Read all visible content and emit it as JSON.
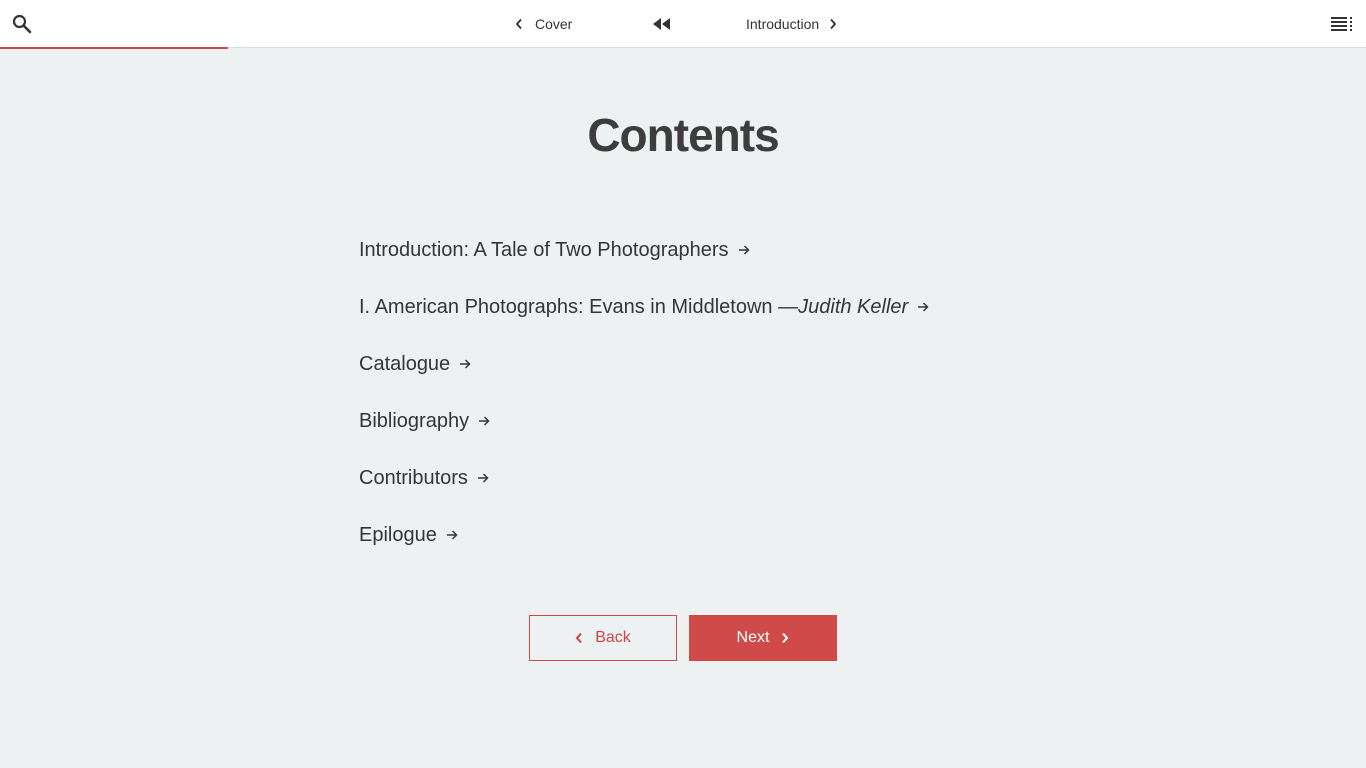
{
  "colors": {
    "accent": "#d04a4a",
    "background": "#edf1f2",
    "topbar": "#ffffff",
    "text": "#3f3f3f"
  },
  "progress": {
    "fraction": 0.167
  },
  "topbar": {
    "search_icon": "search-icon",
    "menu_icon": "menu-icon",
    "prev_label": "Cover",
    "first_icon": "rewind-icon",
    "next_label": "Introduction"
  },
  "page": {
    "title": "Contents"
  },
  "toc": {
    "items": [
      {
        "label": "Introduction: A Tale of Two Photographers",
        "author": ""
      },
      {
        "label": "I. American Photographs: Evans in Middletown — ",
        "author": "Judith Keller"
      },
      {
        "label": "Catalogue",
        "author": ""
      },
      {
        "label": "Bibliography",
        "author": ""
      },
      {
        "label": "Contributors",
        "author": ""
      },
      {
        "label": "Epilogue",
        "author": ""
      }
    ]
  },
  "buttons": {
    "back_label": "Back",
    "next_label": "Next"
  }
}
